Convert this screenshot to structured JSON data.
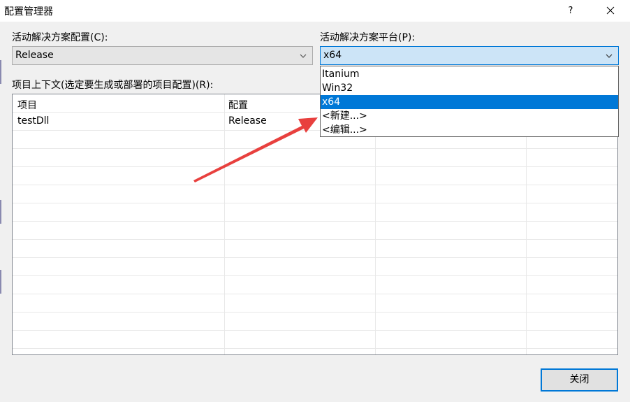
{
  "window": {
    "title": "配置管理器",
    "help": "?"
  },
  "solution_config": {
    "label": "活动解决方案配置(C):",
    "value": "Release"
  },
  "solution_platform": {
    "label": "活动解决方案平台(P):",
    "value": "x64",
    "options": [
      "Itanium",
      "Win32",
      "x64",
      "<新建...>",
      "<编辑...>"
    ],
    "selected_index": 2
  },
  "context": {
    "label": "项目上下文(选定要生成或部署的项目配置)(R):",
    "columns": [
      "项目",
      "配置"
    ],
    "rows": [
      {
        "project": "testDll",
        "config": "Release"
      }
    ]
  },
  "buttons": {
    "close": "关闭"
  },
  "colors": {
    "accent": "#0078d7",
    "annotation_arrow": "#e8403e"
  }
}
